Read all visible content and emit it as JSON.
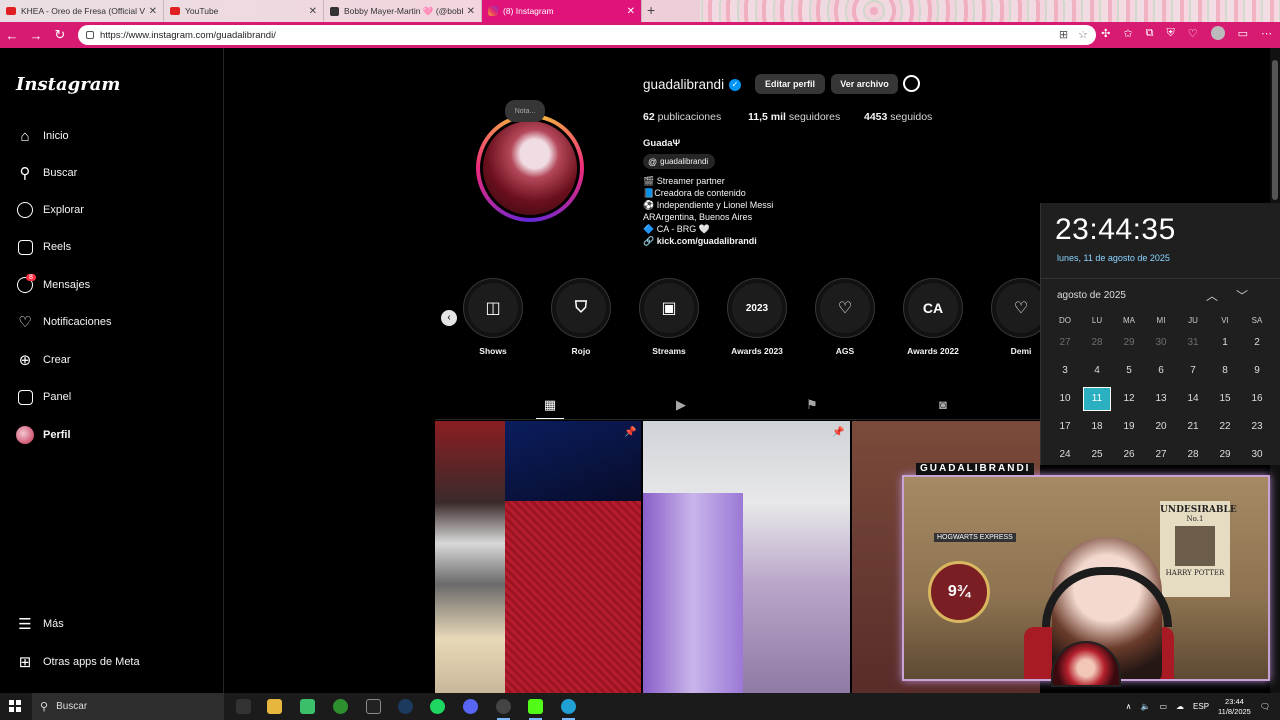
{
  "browser": {
    "tabs": [
      {
        "title": "KHEA - Oreo de Fresa (Official Vi",
        "icon": "youtube-icon"
      },
      {
        "title": "YouTube",
        "icon": "youtube-icon"
      },
      {
        "title": "Bobby Mayer-Martin 🩷 (@bobby",
        "icon": "tiktok-icon"
      },
      {
        "title": "(8) Instagram",
        "icon": "instagram-icon"
      }
    ],
    "url": "https://www.instagram.com/guadalibrandi/",
    "accent": "#d81b72"
  },
  "sidebar": {
    "logo": "Instagram",
    "items": [
      {
        "label": "Inicio",
        "icon": "home-icon"
      },
      {
        "label": "Buscar",
        "icon": "search-icon"
      },
      {
        "label": "Explorar",
        "icon": "compass-icon"
      },
      {
        "label": "Reels",
        "icon": "reels-icon"
      },
      {
        "label": "Mensajes",
        "icon": "messenger-icon",
        "badge": "8"
      },
      {
        "label": "Notificaciones",
        "icon": "heart-icon"
      },
      {
        "label": "Crear",
        "icon": "plus-square-icon"
      },
      {
        "label": "Panel",
        "icon": "chart-icon"
      },
      {
        "label": "Perfil",
        "icon": "avatar"
      }
    ],
    "more": "Más",
    "meta_apps": "Otras apps de Meta"
  },
  "profile": {
    "note": "Nota...",
    "username": "guadalibrandi",
    "edit_button": "Editar perfil",
    "archive_button": "Ver archivo",
    "stats": {
      "posts_count": "62",
      "posts_label": "publicaciones",
      "followers_count": "11,5 mil",
      "followers_label": "seguidores",
      "following_count": "4453",
      "following_label": "seguidos"
    },
    "full_name": "GuadaΨ",
    "threads_handle": "guadalibrandi",
    "bio": [
      "🎬 Streamer partner",
      "📘Creadora de contenido",
      "⚽ Independiente y Lionel Messi",
      "ARArgentina, Buenos Aires",
      "🔷 CA - BRG 🤍",
      "kick.com/guadalibrandi"
    ],
    "highlights": [
      {
        "label": "Shows",
        "glyph": "◫"
      },
      {
        "label": "Rojo",
        "glyph": "⛉"
      },
      {
        "label": "Streams",
        "glyph": "▣"
      },
      {
        "label": "Awards 2023",
        "glyph": "2023"
      },
      {
        "label": "AGS",
        "glyph": "♡"
      },
      {
        "label": "Awards 2022",
        "glyph": "CA"
      },
      {
        "label": "Demi",
        "glyph": "♡"
      }
    ]
  },
  "clock_popup": {
    "time": "23:44:35",
    "date": "lunes, 11 de agosto de 2025",
    "month": "agosto de 2025",
    "weekdays": [
      "DO",
      "LU",
      "MA",
      "MI",
      "JU",
      "VI",
      "SA"
    ],
    "days": [
      {
        "d": "27",
        "dim": true
      },
      {
        "d": "28",
        "dim": true
      },
      {
        "d": "29",
        "dim": true
      },
      {
        "d": "30",
        "dim": true
      },
      {
        "d": "31",
        "dim": true
      },
      {
        "d": "1"
      },
      {
        "d": "2"
      },
      {
        "d": "3"
      },
      {
        "d": "4"
      },
      {
        "d": "5"
      },
      {
        "d": "6"
      },
      {
        "d": "7"
      },
      {
        "d": "8"
      },
      {
        "d": "9"
      },
      {
        "d": "10"
      },
      {
        "d": "11",
        "today": true
      },
      {
        "d": "12"
      },
      {
        "d": "13"
      },
      {
        "d": "14"
      },
      {
        "d": "15"
      },
      {
        "d": "16"
      },
      {
        "d": "17"
      },
      {
        "d": "18"
      },
      {
        "d": "19"
      },
      {
        "d": "20"
      },
      {
        "d": "21"
      },
      {
        "d": "22"
      },
      {
        "d": "23"
      },
      {
        "d": "24"
      },
      {
        "d": "25"
      },
      {
        "d": "26"
      },
      {
        "d": "27"
      },
      {
        "d": "28"
      },
      {
        "d": "29"
      },
      {
        "d": "30"
      }
    ]
  },
  "stream_overlay": {
    "title": "GUADALIBRANDI",
    "poster_line1": "UNDESIRABLE",
    "poster_line2": "No.1",
    "poster_line3": "HARRY POTTER",
    "hogwarts": "HOGWARTS EXPRESS",
    "platform": "9¾"
  },
  "taskbar": {
    "search": "Buscar",
    "lang": "ESP",
    "time": "23:44",
    "date": "11/8/2025"
  }
}
